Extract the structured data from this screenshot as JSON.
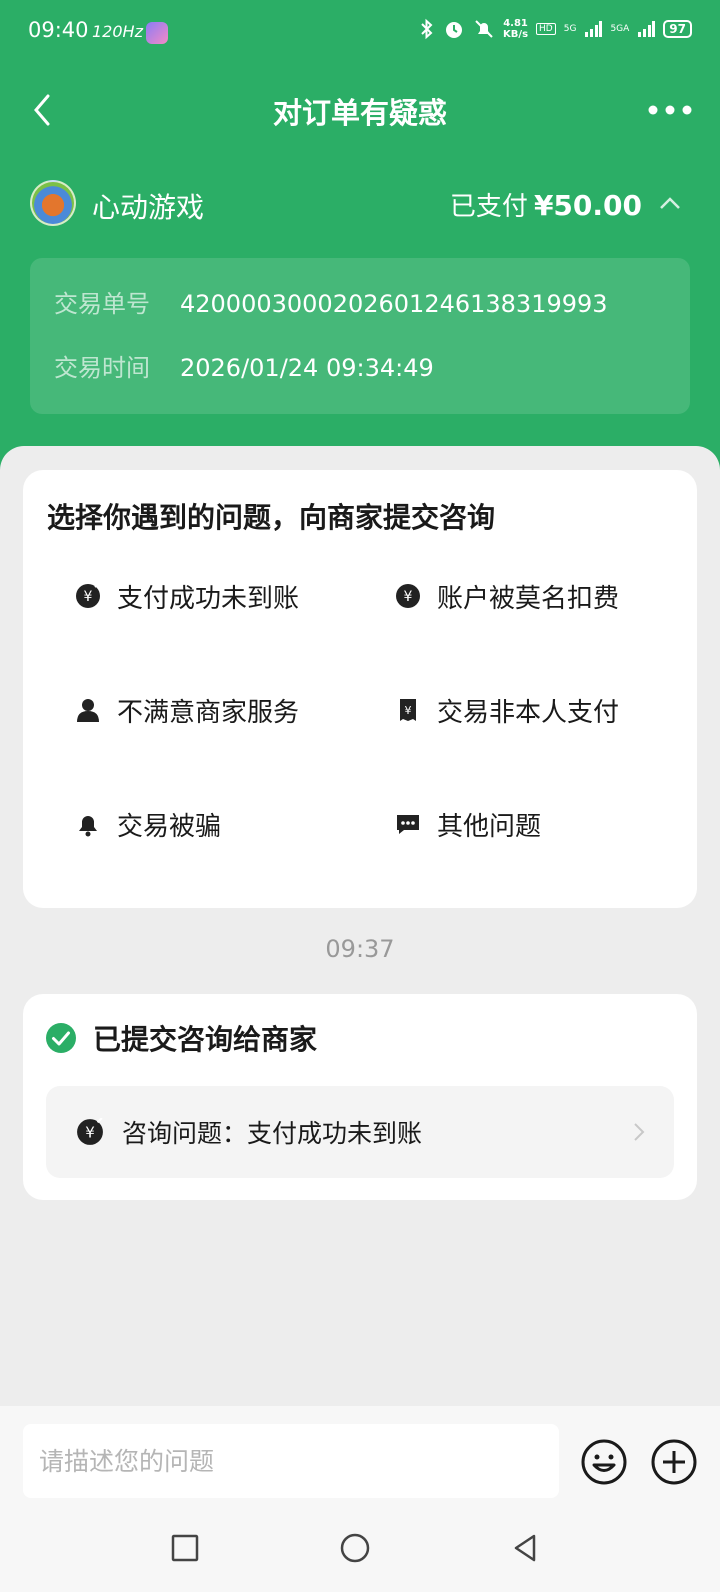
{
  "status_bar": {
    "time": "09:40",
    "refresh_rate": "120Hz",
    "net_speed_value": "4.81",
    "net_speed_unit": "KB/s",
    "hd_tag": "HD",
    "sim1": "5G",
    "sim2": "5GA",
    "battery": "97"
  },
  "nav": {
    "title": "对订单有疑惑",
    "back_icon": "back-chevron-icon",
    "more_icon": "more-dots-icon"
  },
  "merchant": {
    "name": "心动游戏",
    "paid_label": "已支付",
    "amount": "¥50.00"
  },
  "transaction": {
    "id_label": "交易单号",
    "id_value": "4200003000202601246138319993",
    "time_label": "交易时间",
    "time_value": "2026/01/24 09:34:49"
  },
  "question_card": {
    "title": "选择你遇到的问题，向商家提交咨询",
    "options": [
      {
        "label": "支付成功未到账",
        "icon": "yen-slash-icon"
      },
      {
        "label": "账户被莫名扣费",
        "icon": "yen-circle-icon"
      },
      {
        "label": "不满意商家服务",
        "icon": "person-icon"
      },
      {
        "label": "交易非本人支付",
        "icon": "receipt-icon"
      },
      {
        "label": "交易被骗",
        "icon": "bell-icon"
      },
      {
        "label": "其他问题",
        "icon": "chat-dots-icon"
      }
    ]
  },
  "chat": {
    "timestamp": "09:37",
    "submitted_title": "已提交咨询给商家",
    "consult_item": "咨询问题：支付成功未到账"
  },
  "input": {
    "placeholder": "请描述您的问题"
  },
  "colors": {
    "brand_green": "#2bae66",
    "background": "#ededed"
  }
}
